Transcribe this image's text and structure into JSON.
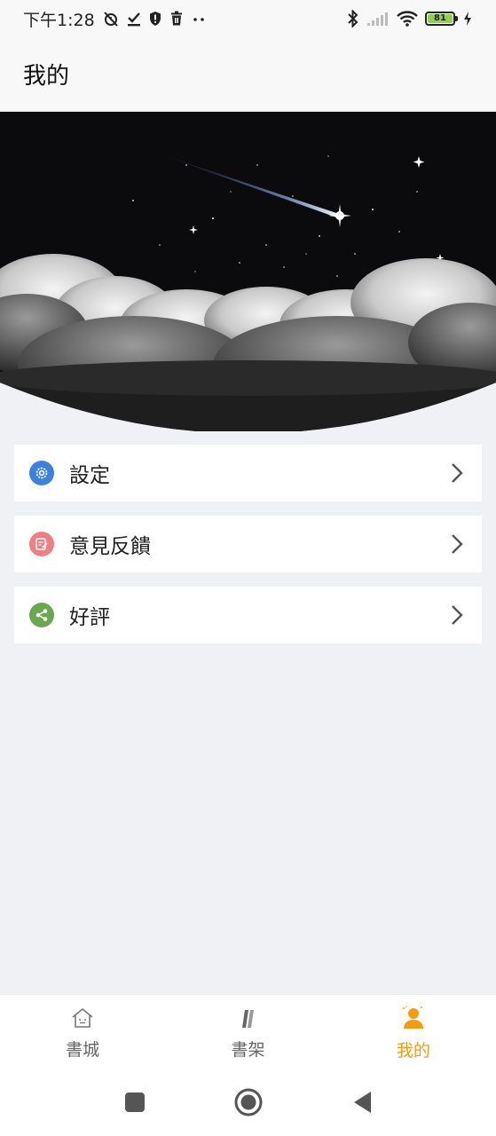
{
  "status_bar": {
    "time": "下午1:28",
    "battery_level": "81",
    "icons_left": [
      "muted-alarm-icon",
      "download-done-icon",
      "shield-icon",
      "trash-icon",
      "more-dots-icon"
    ],
    "icons_right": [
      "bluetooth-icon",
      "signal-icon",
      "wifi-icon",
      "battery-icon",
      "charging-icon"
    ]
  },
  "header": {
    "title": "我的"
  },
  "menu": {
    "items": [
      {
        "label": "設定",
        "icon": "gear-icon",
        "icon_color": "#3b82e0"
      },
      {
        "label": "意見反饋",
        "icon": "edit-note-icon",
        "icon_color": "#ef7f82"
      },
      {
        "label": "好評",
        "icon": "share-icon",
        "icon_color": "#6aa84f"
      }
    ]
  },
  "bottom_nav": {
    "items": [
      {
        "label": "書城",
        "icon": "home-icon",
        "active": false
      },
      {
        "label": "書架",
        "icon": "bookshelf-icon",
        "active": false
      },
      {
        "label": "我的",
        "icon": "person-icon",
        "active": true
      }
    ],
    "active_color": "#f39c12"
  },
  "system_nav": {
    "items": [
      "recents-square-icon",
      "home-circle-icon",
      "back-triangle-icon"
    ]
  }
}
